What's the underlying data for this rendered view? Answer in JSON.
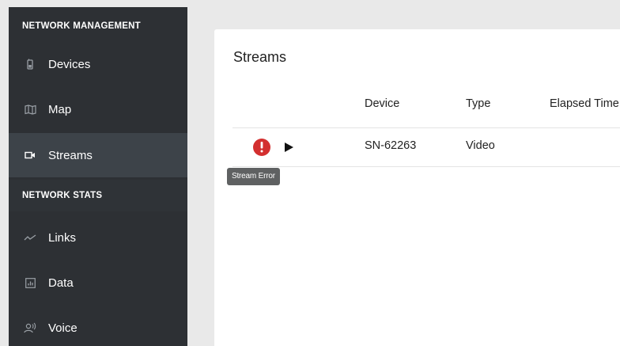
{
  "sidebar": {
    "sections": [
      {
        "header": "NETWORK MANAGEMENT",
        "items": [
          {
            "label": "Devices",
            "icon": "device-icon",
            "active": false
          },
          {
            "label": "Map",
            "icon": "map-icon",
            "active": false
          },
          {
            "label": "Streams",
            "icon": "video-camera-icon",
            "active": true
          }
        ]
      },
      {
        "header": "NETWORK STATS",
        "items": [
          {
            "label": "Links",
            "icon": "trend-line-icon",
            "active": false
          },
          {
            "label": "Data",
            "icon": "bar-chart-icon",
            "active": false
          },
          {
            "label": "Voice",
            "icon": "voice-icon",
            "active": false
          }
        ]
      }
    ]
  },
  "main": {
    "title": "Streams",
    "columns": [
      "Device",
      "Type",
      "Elapsed Time"
    ],
    "rows": [
      {
        "status": "error",
        "device": "SN-62263",
        "type": "Video"
      }
    ],
    "tooltip": "Stream Error"
  },
  "colors": {
    "sidebar_bg": "#2d3034",
    "sidebar_active_bg": "#3d4349",
    "page_bg": "#e9e9e9",
    "error": "#d32f2f",
    "tooltip_bg": "#5f6162"
  }
}
